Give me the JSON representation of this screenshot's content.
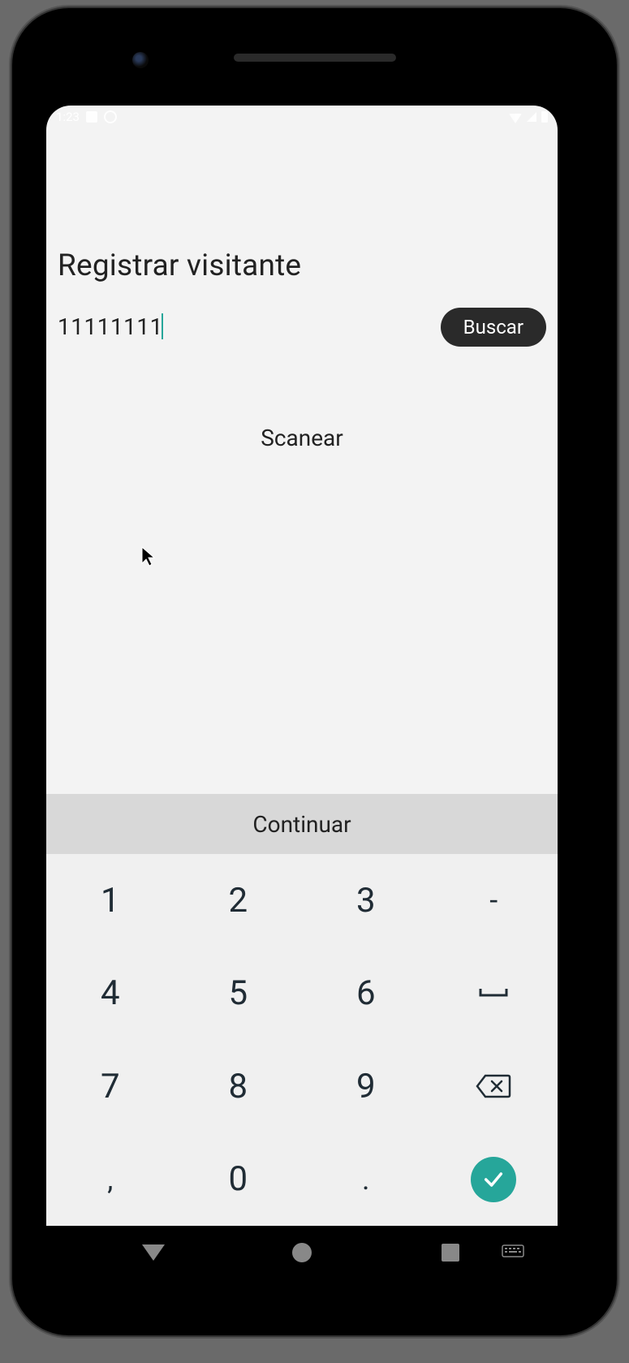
{
  "status": {
    "time": "1:23"
  },
  "page": {
    "title": "Registrar visitante",
    "input_value": "11111111",
    "search_label": "Buscar",
    "scan_label": "Scanear",
    "continue_label": "Continuar"
  },
  "keypad": {
    "k1": "1",
    "k2": "2",
    "k3": "3",
    "kdash": "-",
    "k4": "4",
    "k5": "5",
    "k6": "6",
    "kspace": "␣",
    "k7": "7",
    "k8": "8",
    "k9": "9",
    "kcomma": ",",
    "k0": "0",
    "kdot": "."
  }
}
